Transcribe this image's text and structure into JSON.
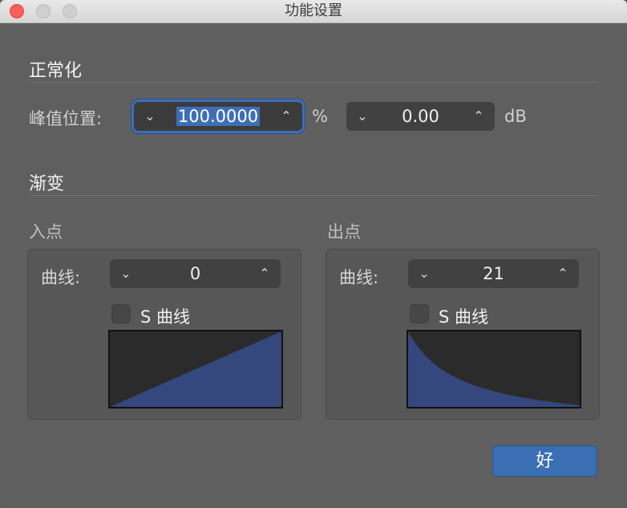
{
  "window": {
    "title": "功能设置"
  },
  "normalize": {
    "section_title": "正常化",
    "peak_label": "峰值位置:",
    "peak_value": "100.0000",
    "peak_unit": "%",
    "db_value": "0.00",
    "db_unit": "dB"
  },
  "fade": {
    "section_title": "渐变",
    "fade_in": {
      "title": "入点",
      "curve_label": "曲线:",
      "curve_value": "0",
      "s_curve_label": "S 曲线",
      "s_curve_checked": false
    },
    "fade_out": {
      "title": "出点",
      "curve_label": "曲线:",
      "curve_value": "21",
      "s_curve_label": "S 曲线",
      "s_curve_checked": false
    }
  },
  "buttons": {
    "ok_label": "好"
  },
  "icons": {
    "stepper_down": "chevron-down-icon",
    "stepper_up": "chevron-up-icon"
  },
  "colors": {
    "accent": "#3a6fb4",
    "curve_fill": "#34487e"
  }
}
